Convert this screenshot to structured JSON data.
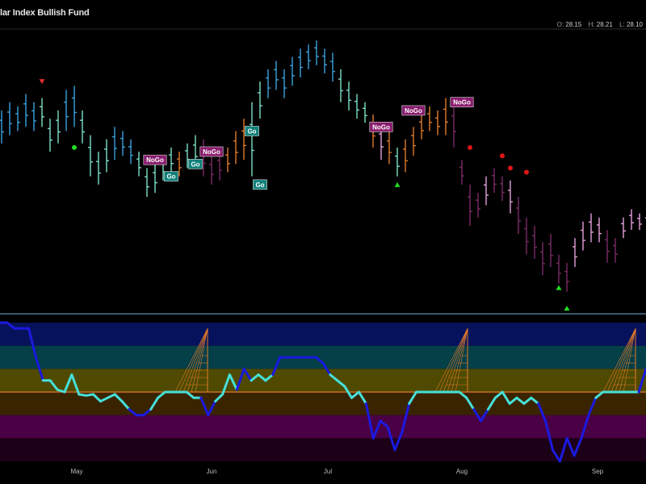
{
  "title": "lar Index Bullish Fund",
  "ohlc": {
    "o_label": "O:",
    "o": "28.15",
    "h_label": "H:",
    "h": "28.21",
    "l_label": "L:",
    "l": "28.10"
  },
  "chart_data": [
    {
      "type": "ohlc",
      "grid": false,
      "colors": {
        "strong_go": "#3aa3dd",
        "go": "#7ee0c8",
        "nogo": "#e07a2a",
        "strong_nogo": "#7a2a66",
        "nogo_light": "#e3a0dc"
      },
      "x_tick_labels": [
        "May",
        "Jun",
        "Jul",
        "Aug",
        "Sep"
      ],
      "bars": [
        {
          "t": 0,
          "h": 40,
          "l": 32,
          "c": "strong_go"
        },
        {
          "t": 1,
          "h": 42,
          "l": 34,
          "c": "strong_go"
        },
        {
          "t": 2,
          "h": 41,
          "l": 35,
          "c": "strong_go"
        },
        {
          "t": 3,
          "h": 44,
          "l": 36,
          "c": "strong_go"
        },
        {
          "t": 4,
          "h": 42,
          "l": 35,
          "c": "strong_go"
        },
        {
          "t": 5,
          "h": 43,
          "l": 36,
          "c": "go"
        },
        {
          "t": 6,
          "h": 38,
          "l": 30,
          "c": "go"
        },
        {
          "t": 7,
          "h": 40,
          "l": 32,
          "c": "go"
        },
        {
          "t": 8,
          "h": 45,
          "l": 35,
          "c": "strong_go"
        },
        {
          "t": 9,
          "h": 46,
          "l": 36,
          "c": "strong_go"
        },
        {
          "t": 10,
          "h": 40,
          "l": 32,
          "c": "go"
        },
        {
          "t": 11,
          "h": 34,
          "l": 24,
          "c": "go"
        },
        {
          "t": 12,
          "h": 30,
          "l": 22,
          "c": "go"
        },
        {
          "t": 13,
          "h": 33,
          "l": 25,
          "c": "go"
        },
        {
          "t": 14,
          "h": 36,
          "l": 28,
          "c": "strong_go"
        },
        {
          "t": 15,
          "h": 35,
          "l": 29,
          "c": "strong_go"
        },
        {
          "t": 16,
          "h": 33,
          "l": 27,
          "c": "strong_go"
        },
        {
          "t": 17,
          "h": 30,
          "l": 24,
          "c": "go"
        },
        {
          "t": 18,
          "h": 26,
          "l": 19,
          "c": "go"
        },
        {
          "t": 19,
          "h": 27,
          "l": 20,
          "c": "go"
        },
        {
          "t": 20,
          "h": 29,
          "l": 23,
          "c": "go"
        },
        {
          "t": 21,
          "h": 31,
          "l": 25,
          "c": "go"
        },
        {
          "t": 22,
          "h": 30,
          "l": 24,
          "c": "nogo"
        },
        {
          "t": 23,
          "h": 32,
          "l": 26,
          "c": "go"
        },
        {
          "t": 24,
          "h": 34,
          "l": 26,
          "c": "go"
        },
        {
          "t": 25,
          "h": 33,
          "l": 24,
          "c": "strong_nogo"
        },
        {
          "t": 26,
          "h": 29,
          "l": 22,
          "c": "strong_nogo"
        },
        {
          "t": 27,
          "h": 30,
          "l": 23,
          "c": "strong_nogo"
        },
        {
          "t": 28,
          "h": 31,
          "l": 25,
          "c": "nogo"
        },
        {
          "t": 29,
          "h": 35,
          "l": 27,
          "c": "nogo"
        },
        {
          "t": 30,
          "h": 38,
          "l": 28,
          "c": "nogo"
        },
        {
          "t": 31,
          "h": 42,
          "l": 24,
          "c": "go"
        },
        {
          "t": 32,
          "h": 47,
          "l": 38,
          "c": "go"
        },
        {
          "t": 33,
          "h": 50,
          "l": 43,
          "c": "strong_go"
        },
        {
          "t": 34,
          "h": 52,
          "l": 45,
          "c": "strong_go"
        },
        {
          "t": 35,
          "h": 50,
          "l": 43,
          "c": "strong_go"
        },
        {
          "t": 36,
          "h": 53,
          "l": 46,
          "c": "strong_go"
        },
        {
          "t": 37,
          "h": 55,
          "l": 48,
          "c": "strong_go"
        },
        {
          "t": 38,
          "h": 56,
          "l": 50,
          "c": "strong_go"
        },
        {
          "t": 39,
          "h": 57,
          "l": 51,
          "c": "strong_go"
        },
        {
          "t": 40,
          "h": 55,
          "l": 49,
          "c": "strong_go"
        },
        {
          "t": 41,
          "h": 54,
          "l": 47,
          "c": "strong_go"
        },
        {
          "t": 42,
          "h": 50,
          "l": 42,
          "c": "go"
        },
        {
          "t": 43,
          "h": 47,
          "l": 40,
          "c": "go"
        },
        {
          "t": 44,
          "h": 44,
          "l": 38,
          "c": "go"
        },
        {
          "t": 45,
          "h": 42,
          "l": 37,
          "c": "go"
        },
        {
          "t": 46,
          "h": 39,
          "l": 31,
          "c": "nogo"
        },
        {
          "t": 47,
          "h": 37,
          "l": 28,
          "c": "nogo_light"
        },
        {
          "t": 48,
          "h": 35,
          "l": 27,
          "c": "nogo"
        },
        {
          "t": 49,
          "h": 31,
          "l": 24,
          "c": "go"
        },
        {
          "t": 50,
          "h": 33,
          "l": 25,
          "c": "nogo"
        },
        {
          "t": 51,
          "h": 36,
          "l": 29,
          "c": "nogo"
        },
        {
          "t": 52,
          "h": 39,
          "l": 33,
          "c": "nogo"
        },
        {
          "t": 53,
          "h": 41,
          "l": 35,
          "c": "nogo"
        },
        {
          "t": 54,
          "h": 40,
          "l": 34,
          "c": "nogo"
        },
        {
          "t": 55,
          "h": 43,
          "l": 34,
          "c": "nogo"
        },
        {
          "t": 56,
          "h": 42,
          "l": 31,
          "c": "strong_nogo"
        },
        {
          "t": 57,
          "h": 28,
          "l": 22,
          "c": "strong_nogo"
        },
        {
          "t": 58,
          "h": 22,
          "l": 12,
          "c": "strong_nogo"
        },
        {
          "t": 59,
          "h": 20,
          "l": 14,
          "c": "strong_nogo"
        },
        {
          "t": 60,
          "h": 24,
          "l": 17,
          "c": "nogo_light"
        },
        {
          "t": 61,
          "h": 26,
          "l": 20,
          "c": "strong_nogo"
        },
        {
          "t": 62,
          "h": 24,
          "l": 18,
          "c": "strong_nogo"
        },
        {
          "t": 63,
          "h": 23,
          "l": 15,
          "c": "nogo_light"
        },
        {
          "t": 64,
          "h": 19,
          "l": 10,
          "c": "strong_nogo"
        },
        {
          "t": 65,
          "h": 14,
          "l": 5,
          "c": "strong_nogo"
        },
        {
          "t": 66,
          "h": 12,
          "l": 4,
          "c": "strong_nogo"
        },
        {
          "t": 67,
          "h": 8,
          "l": 0,
          "c": "strong_nogo"
        },
        {
          "t": 68,
          "h": 10,
          "l": 2,
          "c": "strong_nogo"
        },
        {
          "t": 69,
          "h": 5,
          "l": -2,
          "c": "strong_nogo"
        },
        {
          "t": 70,
          "h": 3,
          "l": -4,
          "c": "strong_nogo"
        },
        {
          "t": 71,
          "h": 9,
          "l": 2,
          "c": "nogo_light"
        },
        {
          "t": 72,
          "h": 13,
          "l": 6,
          "c": "nogo_light"
        },
        {
          "t": 73,
          "h": 15,
          "l": 8,
          "c": "nogo_light"
        },
        {
          "t": 74,
          "h": 14,
          "l": 8,
          "c": "nogo_light"
        },
        {
          "t": 75,
          "h": 11,
          "l": 3,
          "c": "strong_nogo"
        },
        {
          "t": 76,
          "h": 9,
          "l": 3,
          "c": "strong_nogo"
        },
        {
          "t": 77,
          "h": 14,
          "l": 9,
          "c": "nogo_light"
        },
        {
          "t": 78,
          "h": 16,
          "l": 11,
          "c": "nogo_light"
        },
        {
          "t": 79,
          "h": 15,
          "l": 11,
          "c": "nogo_light"
        },
        {
          "t": 80,
          "h": 16,
          "l": 9,
          "c": "nogo_light"
        }
      ],
      "markers": [
        {
          "t": 5,
          "v": 47,
          "kind": "tri-down",
          "color": "#e03030"
        },
        {
          "t": 9,
          "v": 31,
          "kind": "dot",
          "color": "#22dd22"
        },
        {
          "t": 49,
          "v": 22,
          "kind": "tri-up",
          "color": "#22dd22"
        },
        {
          "t": 58,
          "v": 31,
          "kind": "dot",
          "color": "#e01515"
        },
        {
          "t": 62,
          "v": 29,
          "kind": "dot",
          "color": "#e01515"
        },
        {
          "t": 63,
          "v": 26,
          "kind": "dot",
          "color": "#e01515"
        },
        {
          "t": 65,
          "v": 25,
          "kind": "dot",
          "color": "#e01515"
        },
        {
          "t": 69,
          "v": -3,
          "kind": "tri-up",
          "color": "#22dd22"
        },
        {
          "t": 70,
          "v": -8,
          "kind": "tri-up",
          "color": "#22dd22"
        },
        {
          "t": 32,
          "v": 22,
          "kind": "dot",
          "color": "#22dd22"
        }
      ],
      "labels": [
        {
          "t": 19,
          "v": 28,
          "text": "NoGo",
          "bg": "#8a1d6e"
        },
        {
          "t": 21,
          "v": 24,
          "text": "Go",
          "bg": "#11807a"
        },
        {
          "t": 24,
          "v": 27,
          "text": "Go",
          "bg": "#11807a"
        },
        {
          "t": 26,
          "v": 30,
          "text": "NoGo",
          "bg": "#8a1d6e"
        },
        {
          "t": 31,
          "v": 35,
          "text": "Go",
          "bg": "#11807a"
        },
        {
          "t": 32,
          "v": 22,
          "text": "Go",
          "bg": "#11807a"
        },
        {
          "t": 47,
          "v": 36,
          "text": "NoGo",
          "bg": "#8a1d6e"
        },
        {
          "t": 51,
          "v": 40,
          "text": "NoGo",
          "bg": "#8a1d6e"
        },
        {
          "t": 57,
          "v": 42,
          "text": "NoGo",
          "bg": "#8a1d6e"
        }
      ]
    },
    {
      "type": "line",
      "grid": false,
      "ylim": [
        -6,
        6
      ],
      "bands": [
        {
          "from": 4,
          "to": 6,
          "color": "#07125c"
        },
        {
          "from": 2,
          "to": 4,
          "color": "#053f48"
        },
        {
          "from": 0,
          "to": 2,
          "color": "#4f4a00"
        },
        {
          "from": -2,
          "to": 0,
          "color": "#3a2400"
        },
        {
          "from": -4,
          "to": -2,
          "color": "#4a0045"
        },
        {
          "from": -6,
          "to": -4,
          "color": "#1c0018"
        }
      ],
      "zero_line_color": "#e0772a",
      "series": [
        {
          "colors": {
            "strong": "#1a1ae0",
            "weak": "#45e0d8"
          },
          "values": [
            6,
            6,
            5.5,
            5.5,
            5.5,
            3,
            1,
            1,
            0.2,
            0,
            1.5,
            -0.2,
            -0.3,
            -0.2,
            -0.8,
            -0.5,
            -0.2,
            -0.8,
            -1.5,
            -2,
            -2,
            -1.5,
            -0.5,
            0,
            0,
            0,
            0,
            -0.5,
            -0.5,
            -2,
            -0.8,
            -0.2,
            1.5,
            0.2,
            2,
            1,
            1.5,
            1,
            1.5,
            3,
            3,
            3,
            3,
            3,
            3,
            2.5,
            1.5,
            1,
            0.5,
            -0.5,
            0,
            -1,
            -4,
            -2.5,
            -3,
            -5,
            -3.5,
            -1,
            0,
            0,
            0,
            0,
            0,
            0,
            0,
            -0.5,
            -1.5,
            -2.5,
            -1.5,
            -0.5,
            0,
            -1,
            -0.5,
            -1,
            -0.5,
            -1,
            -2.5,
            -5,
            -6,
            -4,
            -5.5,
            -4,
            -2,
            -0.5,
            0,
            0,
            0,
            0,
            0,
            0,
            2
          ]
        }
      ],
      "strong_threshold": 2,
      "x_tick_labels": [
        "May",
        "Jun",
        "Jul",
        "Aug",
        "Sep"
      ]
    }
  ]
}
